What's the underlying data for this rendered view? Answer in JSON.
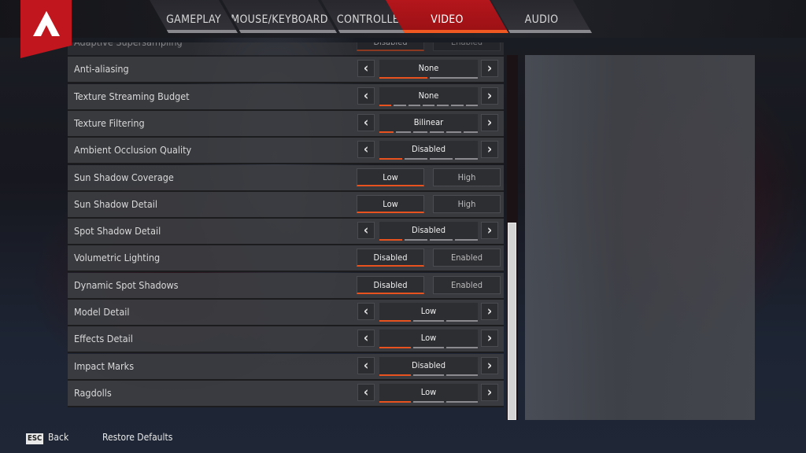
{
  "tabs": [
    {
      "label": "GAMEPLAY",
      "active": false
    },
    {
      "label": "MOUSE/KEYBOARD",
      "active": false
    },
    {
      "label": "CONTROLLER",
      "active": false
    },
    {
      "label": "VIDEO",
      "active": true
    },
    {
      "label": "AUDIO",
      "active": false
    }
  ],
  "settings": [
    {
      "label": "Adaptive Supersampling",
      "type": "toggle",
      "options": [
        "Disabled",
        "Enabled"
      ],
      "selected": 0,
      "partial": true
    },
    {
      "label": "Anti-aliasing",
      "type": "cycle",
      "value": "None",
      "levels": 2,
      "level": 1
    },
    {
      "label": "Texture Streaming Budget",
      "type": "cycle",
      "value": "None",
      "levels": 7,
      "level": 1
    },
    {
      "label": "Texture Filtering",
      "type": "cycle",
      "value": "Bilinear",
      "levels": 6,
      "level": 1
    },
    {
      "label": "Ambient Occlusion Quality",
      "type": "cycle",
      "value": "Disabled",
      "levels": 4,
      "level": 1
    },
    {
      "label": "Sun Shadow Coverage",
      "type": "toggle",
      "options": [
        "Low",
        "High"
      ],
      "selected": 0
    },
    {
      "label": "Sun Shadow Detail",
      "type": "toggle",
      "options": [
        "Low",
        "High"
      ],
      "selected": 0
    },
    {
      "label": "Spot Shadow Detail",
      "type": "cycle",
      "value": "Disabled",
      "levels": 4,
      "level": 1
    },
    {
      "label": "Volumetric Lighting",
      "type": "toggle",
      "options": [
        "Disabled",
        "Enabled"
      ],
      "selected": 0
    },
    {
      "label": "Dynamic Spot Shadows",
      "type": "toggle",
      "options": [
        "Disabled",
        "Enabled"
      ],
      "selected": 0
    },
    {
      "label": "Model Detail",
      "type": "cycle",
      "value": "Low",
      "levels": 3,
      "level": 1
    },
    {
      "label": "Effects Detail",
      "type": "cycle",
      "value": "Low",
      "levels": 3,
      "level": 1
    },
    {
      "label": "Impact Marks",
      "type": "cycle",
      "value": "Disabled",
      "levels": 3,
      "level": 1
    },
    {
      "label": "Ragdolls",
      "type": "cycle",
      "value": "Low",
      "levels": 3,
      "level": 1
    }
  ],
  "arrows": {
    "left": "‹",
    "right": "›"
  },
  "footer": {
    "esc_key": "ESC",
    "back_label": "Back",
    "restore_label": "Restore Defaults"
  },
  "colors": {
    "accent_red": "#c1161d",
    "active_underline": "#e8521f"
  }
}
